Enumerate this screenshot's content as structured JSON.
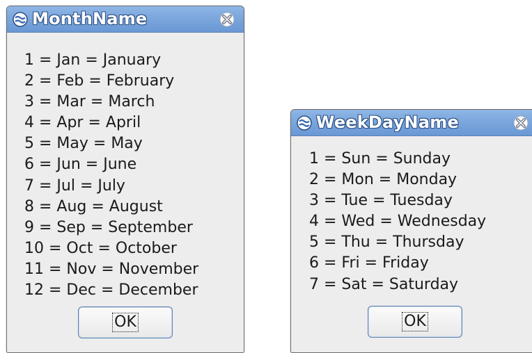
{
  "windows": {
    "month": {
      "title": "MonthName",
      "items": [
        "1 = Jan = January",
        "2 = Feb = February",
        "3 = Mar = March",
        "4 = Apr = April",
        "5 = May = May",
        "6 = Jun = June",
        "7 = Jul = July",
        "8 = Aug = August",
        "9 = Sep = September",
        "10 = Oct = October",
        "11 = Nov = November",
        "12 = Dec = December"
      ],
      "ok_label": "OK"
    },
    "week": {
      "title": "WeekDayName",
      "items": [
        "1 = Sun = Sunday",
        "2 = Mon = Monday",
        "3 = Tue = Tuesday",
        "4 = Wed = Wednesday",
        "5 = Thu = Thursday",
        "6 = Fri = Friday",
        "7 = Sat = Saturday"
      ],
      "ok_label": "OK"
    }
  },
  "icons": {
    "app": "app-menu-icon",
    "close": "close-icon"
  },
  "colors": {
    "titlebar": "#7aa5dc",
    "title_outline": "#2b4f86",
    "window_bg": "#ededed",
    "button_border": "#5e83b3"
  }
}
